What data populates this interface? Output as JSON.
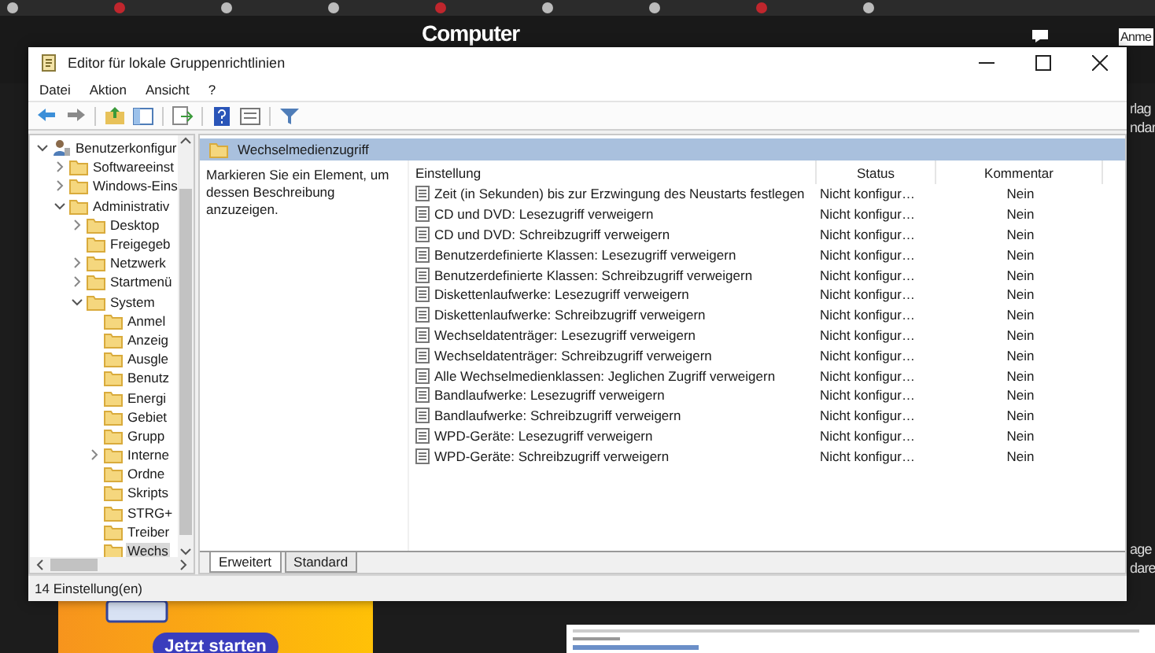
{
  "browser": {
    "site_logo": "Computer",
    "header_button": "Anme",
    "side_texts": [
      "rlag",
      "ndar"
    ],
    "lower_side_texts": [
      "age",
      "dare"
    ],
    "ad_button": "Jetzt starten"
  },
  "window": {
    "title": "Editor für lokale Gruppenrichtlinien",
    "menu": [
      "Datei",
      "Aktion",
      "Ansicht",
      "?"
    ],
    "tree": [
      {
        "label": "Benutzerkonfigur",
        "kind": "user",
        "expanded": true,
        "selected": false,
        "children": [
          {
            "label": "Softwareeinst",
            "expanded": false,
            "selected": false
          },
          {
            "label": "Windows-Eins",
            "expanded": false,
            "selected": false
          },
          {
            "label": "Administrativ",
            "expanded": true,
            "selected": false,
            "children": [
              {
                "label": "Desktop",
                "expanded": false,
                "selected": false
              },
              {
                "label": "Freigegeb",
                "selected": false
              },
              {
                "label": "Netzwerk",
                "expanded": false,
                "selected": false
              },
              {
                "label": "Startmenü",
                "expanded": false,
                "selected": false
              },
              {
                "label": "System",
                "expanded": true,
                "selected": false,
                "children": [
                  {
                    "label": "Anmel",
                    "selected": false
                  },
                  {
                    "label": "Anzeig",
                    "selected": false
                  },
                  {
                    "label": "Ausgle",
                    "selected": false
                  },
                  {
                    "label": "Benutz",
                    "selected": false
                  },
                  {
                    "label": "Energi",
                    "selected": false
                  },
                  {
                    "label": "Gebiet",
                    "selected": false
                  },
                  {
                    "label": "Grupp",
                    "selected": false
                  },
                  {
                    "label": "Interne",
                    "expanded": false,
                    "selected": false
                  },
                  {
                    "label": "Ordne",
                    "selected": false
                  },
                  {
                    "label": "Skripts",
                    "selected": false
                  },
                  {
                    "label": "STRG+",
                    "selected": false
                  },
                  {
                    "label": "Treiber",
                    "selected": false
                  },
                  {
                    "label": "Wechs",
                    "selected": true
                  }
                ]
              }
            ]
          }
        ]
      }
    ],
    "pane_title": "Wechselmedienzugriff",
    "description": "Markieren Sie ein Element, um dessen Beschreibung anzuzeigen.",
    "table": {
      "columns": [
        "Einstellung",
        "Status",
        "Kommentar"
      ],
      "rows": [
        {
          "setting": "Zeit (in Sekunden) bis zur Erzwingung des Neustarts festlegen",
          "status": "Nicht konfigur…",
          "comment": "Nein"
        },
        {
          "setting": "CD und DVD: Lesezugriff verweigern",
          "status": "Nicht konfigur…",
          "comment": "Nein"
        },
        {
          "setting": "CD und DVD: Schreibzugriff verweigern",
          "status": "Nicht konfigur…",
          "comment": "Nein"
        },
        {
          "setting": "Benutzerdefinierte Klassen: Lesezugriff verweigern",
          "status": "Nicht konfigur…",
          "comment": "Nein"
        },
        {
          "setting": "Benutzerdefinierte Klassen: Schreibzugriff verweigern",
          "status": "Nicht konfigur…",
          "comment": "Nein"
        },
        {
          "setting": "Diskettenlaufwerke: Lesezugriff verweigern",
          "status": "Nicht konfigur…",
          "comment": "Nein"
        },
        {
          "setting": "Diskettenlaufwerke: Schreibzugriff verweigern",
          "status": "Nicht konfigur…",
          "comment": "Nein"
        },
        {
          "setting": "Wechseldatenträger: Lesezugriff verweigern",
          "status": "Nicht konfigur…",
          "comment": "Nein"
        },
        {
          "setting": "Wechseldatenträger: Schreibzugriff verweigern",
          "status": "Nicht konfigur…",
          "comment": "Nein"
        },
        {
          "setting": "Alle Wechselmedienklassen: Jeglichen Zugriff verweigern",
          "status": "Nicht konfigur…",
          "comment": "Nein"
        },
        {
          "setting": "Bandlaufwerke: Lesezugriff verweigern",
          "status": "Nicht konfigur…",
          "comment": "Nein"
        },
        {
          "setting": "Bandlaufwerke: Schreibzugriff verweigern",
          "status": "Nicht konfigur…",
          "comment": "Nein"
        },
        {
          "setting": "WPD-Geräte: Lesezugriff verweigern",
          "status": "Nicht konfigur…",
          "comment": "Nein"
        },
        {
          "setting": "WPD-Geräte: Schreibzugriff verweigern",
          "status": "Nicht konfigur…",
          "comment": "Nein"
        }
      ]
    },
    "tabs": [
      {
        "label": "Erweitert",
        "selected": true
      },
      {
        "label": "Standard",
        "selected": false
      }
    ],
    "status_bar": "14 Einstellung(en)"
  }
}
